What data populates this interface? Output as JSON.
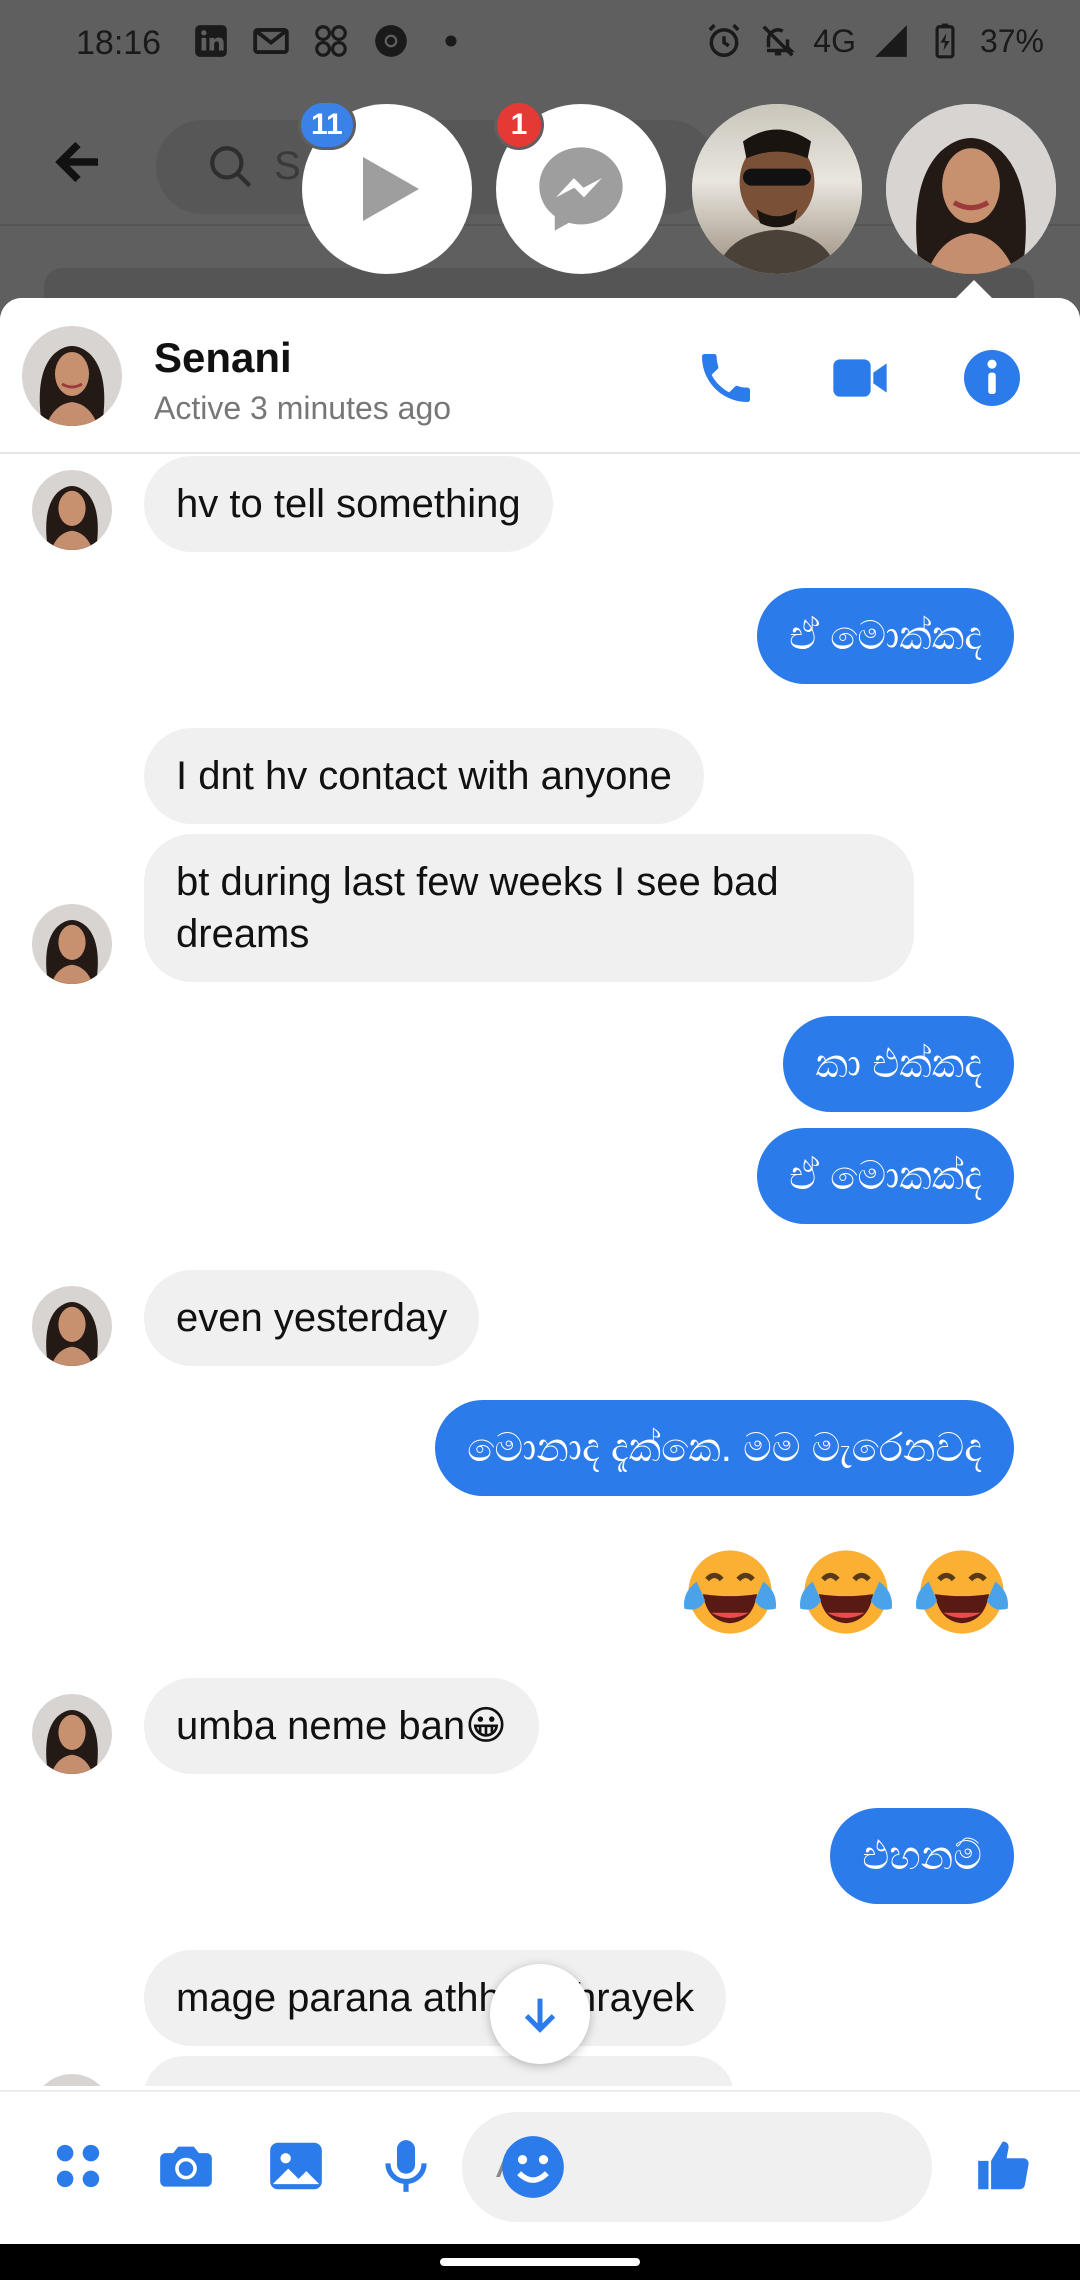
{
  "status_bar": {
    "time": "18:16",
    "network": "4G",
    "battery": "37%",
    "left_icons": [
      "linkedin-icon",
      "gmail-icon",
      "app-icon",
      "chrome-icon",
      "dot-icon"
    ],
    "right_icons": [
      "alarm-icon",
      "mute-icon",
      "signal-icon",
      "battery-charging-icon"
    ]
  },
  "background_app": {
    "search_partial": "S"
  },
  "chat_heads": [
    {
      "name": "video-head",
      "badge": "11"
    },
    {
      "name": "messenger-head",
      "badge": "1"
    },
    {
      "name": "contact-head-man"
    },
    {
      "name": "contact-head-senani"
    }
  ],
  "header": {
    "name": "Senani",
    "status": "Active 3 minutes ago"
  },
  "messages": [
    {
      "side": "in",
      "text": "hv to tell something"
    },
    {
      "side": "out",
      "text": "ඒ මොක්කද"
    },
    {
      "side": "in",
      "text": "I dnt hv contact with anyone"
    },
    {
      "side": "in",
      "text": "bt during last few weeks I see bad dreams"
    },
    {
      "side": "out",
      "text": "කා එක්කද"
    },
    {
      "side": "out",
      "text": "ඒ මොකක්ද"
    },
    {
      "side": "in",
      "text": "even yesterday"
    },
    {
      "side": "out",
      "text": "මොනාද දැක්කෙ. මම මැරෙනවද"
    },
    {
      "side": "out",
      "emoji": [
        "face-with-tears-of-joy",
        "face-with-tears-of-joy",
        "face-with-tears-of-joy"
      ]
    },
    {
      "side": "in",
      "text": "umba neme ban😀"
    },
    {
      "side": "out",
      "text": "එහනම්"
    },
    {
      "side": "in",
      "text": "mage parana athhi mithrayek"
    }
  ],
  "composer": {
    "placeholder": "Aa"
  },
  "colors": {
    "accent": "#2b7bea",
    "incoming_bubble": "#f0f0f0",
    "badge_blue": "#3b82e8",
    "badge_red": "#e53935"
  }
}
